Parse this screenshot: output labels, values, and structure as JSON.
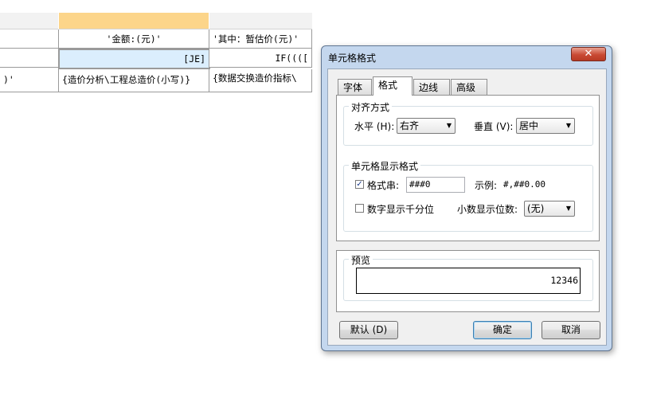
{
  "sheet": {
    "rows": [
      [
        "",
        "'金额:(元)'",
        "'其中：暂估价(元)'"
      ],
      [
        "",
        "[JE]",
        "IF(((["
      ],
      [
        ")'",
        "{造价分析\\工程总造价(小写)}",
        "{数据交换造价指标\\"
      ]
    ]
  },
  "dialog": {
    "title": "单元格格式",
    "close_glyph": "✕",
    "tabs": [
      "字体",
      "格式",
      "边线",
      "高级"
    ],
    "active_tab": "格式",
    "alignment": {
      "group_label": "对齐方式",
      "horizontal_label": "水平 (H):",
      "horizontal_value": "右齐",
      "vertical_label": "垂直 (V):",
      "vertical_value": "居中"
    },
    "display_format": {
      "group_label": "单元格显示格式",
      "format_string_label": "格式串:",
      "format_string_checked": true,
      "format_string_value": "###0",
      "example_label": "示例:",
      "example_value": "#,##0.00",
      "thousands_label": "数字显示千分位",
      "thousands_checked": false,
      "decimals_label": "小数显示位数:",
      "decimals_value": "(无)"
    },
    "preview": {
      "group_label": "预览",
      "value": "12346"
    },
    "buttons": {
      "default": "默认 (D)",
      "ok": "确定",
      "cancel": "取消"
    }
  }
}
